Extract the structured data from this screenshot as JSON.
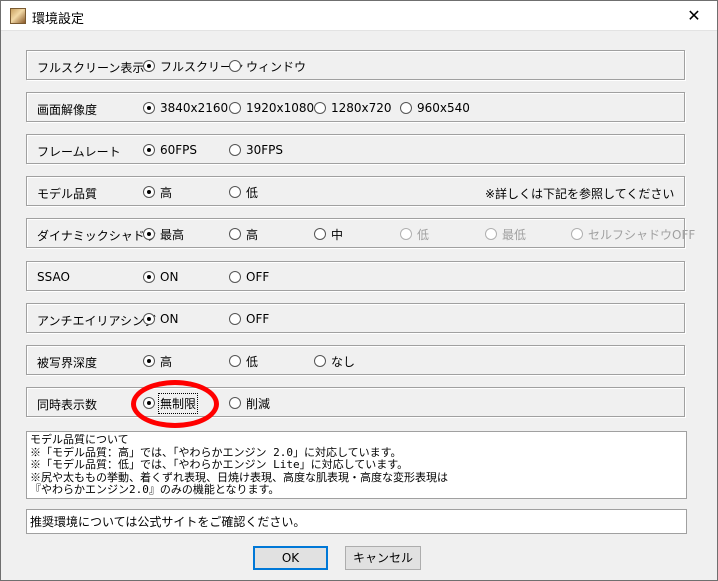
{
  "window": {
    "title": "環境設定",
    "close_symbol": "✕",
    "icon": "app-icon"
  },
  "rows": [
    {
      "id": "fullscreen",
      "label": "フルスクリーン表示",
      "options": [
        {
          "label": "フルスクリーン",
          "checked": true
        },
        {
          "label": "ウィンドウ",
          "checked": false
        }
      ]
    },
    {
      "id": "resolution",
      "label": "画面解像度",
      "options": [
        {
          "label": "3840x2160",
          "checked": true
        },
        {
          "label": "1920x1080",
          "checked": false
        },
        {
          "label": "1280x720",
          "checked": false
        },
        {
          "label": "960x540",
          "checked": false
        }
      ]
    },
    {
      "id": "framerate",
      "label": "フレームレート",
      "options": [
        {
          "label": "60FPS",
          "checked": true
        },
        {
          "label": "30FPS",
          "checked": false
        }
      ]
    },
    {
      "id": "model-quality",
      "label": "モデル品質",
      "options": [
        {
          "label": "高",
          "checked": true
        },
        {
          "label": "低",
          "checked": false
        }
      ],
      "note": "※詳しくは下記を参照してください"
    },
    {
      "id": "dynamic-shadow",
      "label": "ダイナミックシャドウ",
      "options": [
        {
          "label": "最高",
          "checked": true
        },
        {
          "label": "高",
          "checked": false
        },
        {
          "label": "中",
          "checked": false
        },
        {
          "label": "低",
          "checked": false,
          "disabled": true
        },
        {
          "label": "最低",
          "checked": false,
          "disabled": true
        },
        {
          "label": "セルフシャドウOFF",
          "checked": false,
          "disabled": true
        }
      ]
    },
    {
      "id": "ssao",
      "label": "SSAO",
      "options": [
        {
          "label": "ON",
          "checked": true
        },
        {
          "label": "OFF",
          "checked": false
        }
      ]
    },
    {
      "id": "antialiasing",
      "label": "アンチエイリアシング",
      "options": [
        {
          "label": "ON",
          "checked": true
        },
        {
          "label": "OFF",
          "checked": false
        }
      ]
    },
    {
      "id": "depth-of-field",
      "label": "被写界深度",
      "options": [
        {
          "label": "高",
          "checked": true
        },
        {
          "label": "低",
          "checked": false
        },
        {
          "label": "なし",
          "checked": false
        }
      ]
    },
    {
      "id": "simultaneous-display",
      "label": "同時表示数",
      "options": [
        {
          "label": "無制限",
          "checked": true,
          "focused": true
        },
        {
          "label": "削減",
          "checked": false
        }
      ]
    }
  ],
  "info": {
    "lines": [
      "モデル品質について",
      "※「モデル品質：高」では、「やわらかエンジン 2.0」に対応しています。",
      "※「モデル品質：低」では、「やわらかエンジン Lite」に対応しています。",
      "※尻や太ももの挙動、着くずれ表現、日焼け表現、高度な肌表現・高度な変形表現は",
      "『やわらかエンジン2.0』のみの機能となります。"
    ]
  },
  "status_text": "推奨環境については公式サイトをご確認ください。",
  "buttons": {
    "ok": "OK",
    "cancel": "キャンセル"
  },
  "colors": {
    "highlight": "#ff0000",
    "focus_border": "#0078d7"
  }
}
